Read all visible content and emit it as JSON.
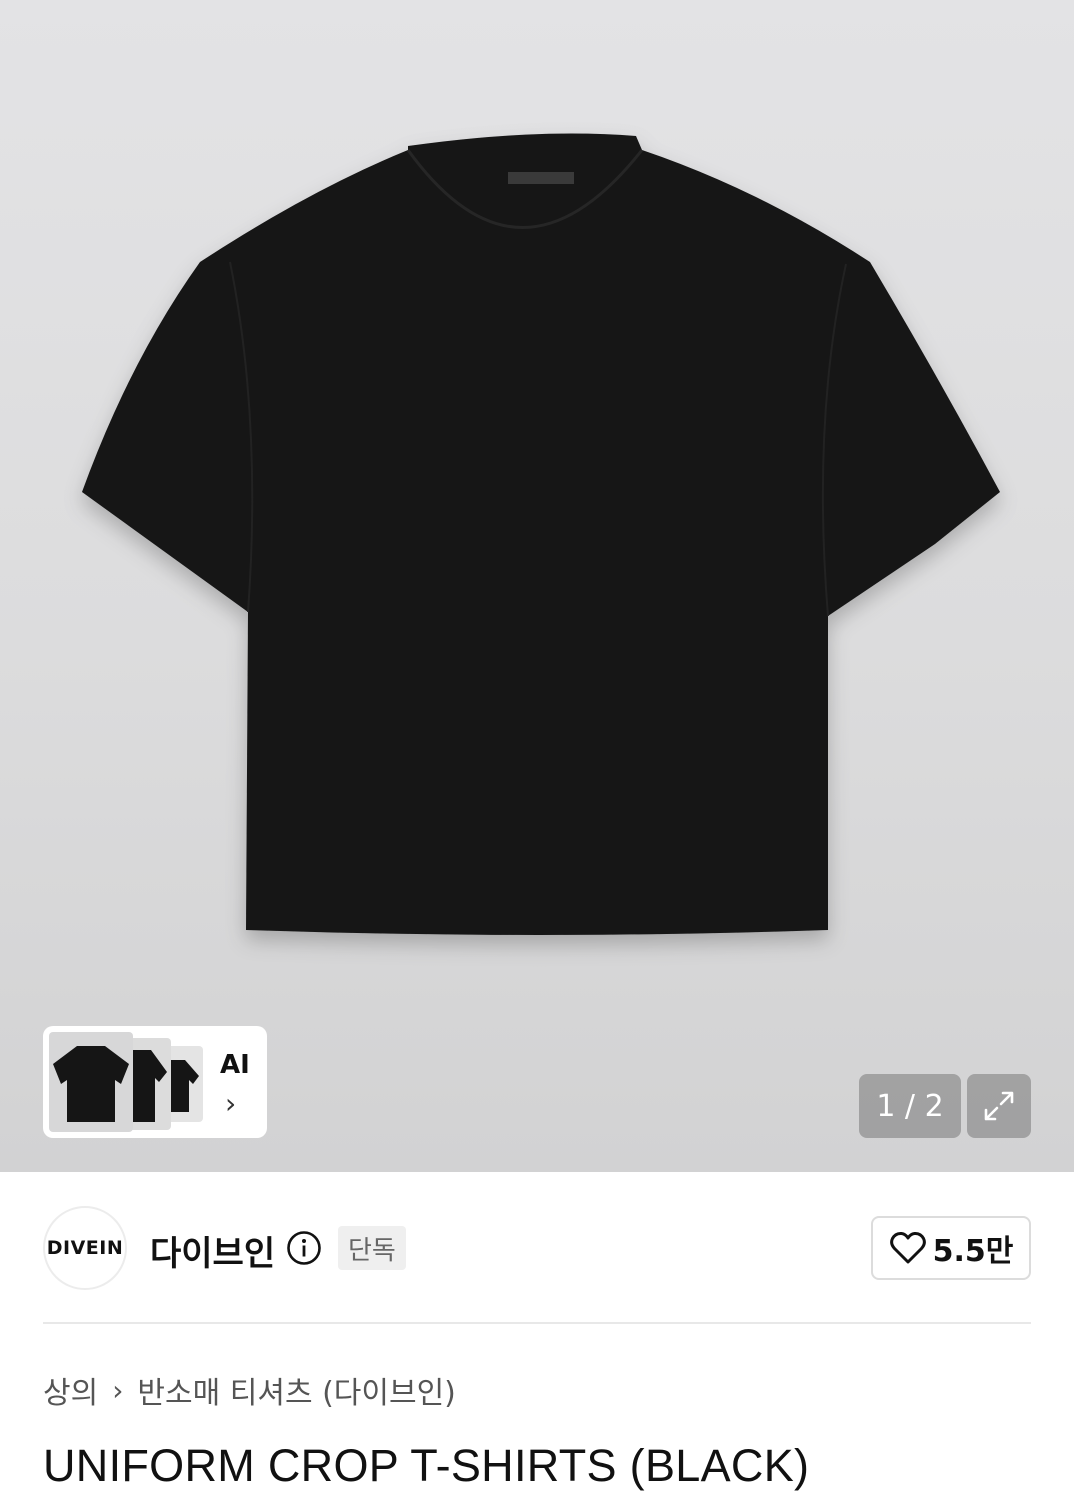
{
  "gallery": {
    "ai_label": "AI",
    "ai_chevron_icon": "chevron-right-icon",
    "page_counter": "1 / 2",
    "expand_icon": "expand-arrows-icon",
    "thumbnail_count": 3
  },
  "brand": {
    "logo_text": "DIVEIN",
    "name": "다이브인",
    "info_icon": "info-circle-icon",
    "badge": "단독",
    "like_icon": "heart-outline-icon",
    "like_count": "5.5만"
  },
  "breadcrumb": {
    "items": [
      "상의",
      "반소매 티셔츠 (다이브인)"
    ],
    "separator_icon": "chevron-right-icon"
  },
  "product": {
    "title": "UNIFORM CROP T-SHIRTS (BLACK)",
    "color": "#151515"
  },
  "colors": {
    "hero_background": "#dcdcdd",
    "overlay_button": "#8c8c8c",
    "badge_background": "#efefef"
  }
}
